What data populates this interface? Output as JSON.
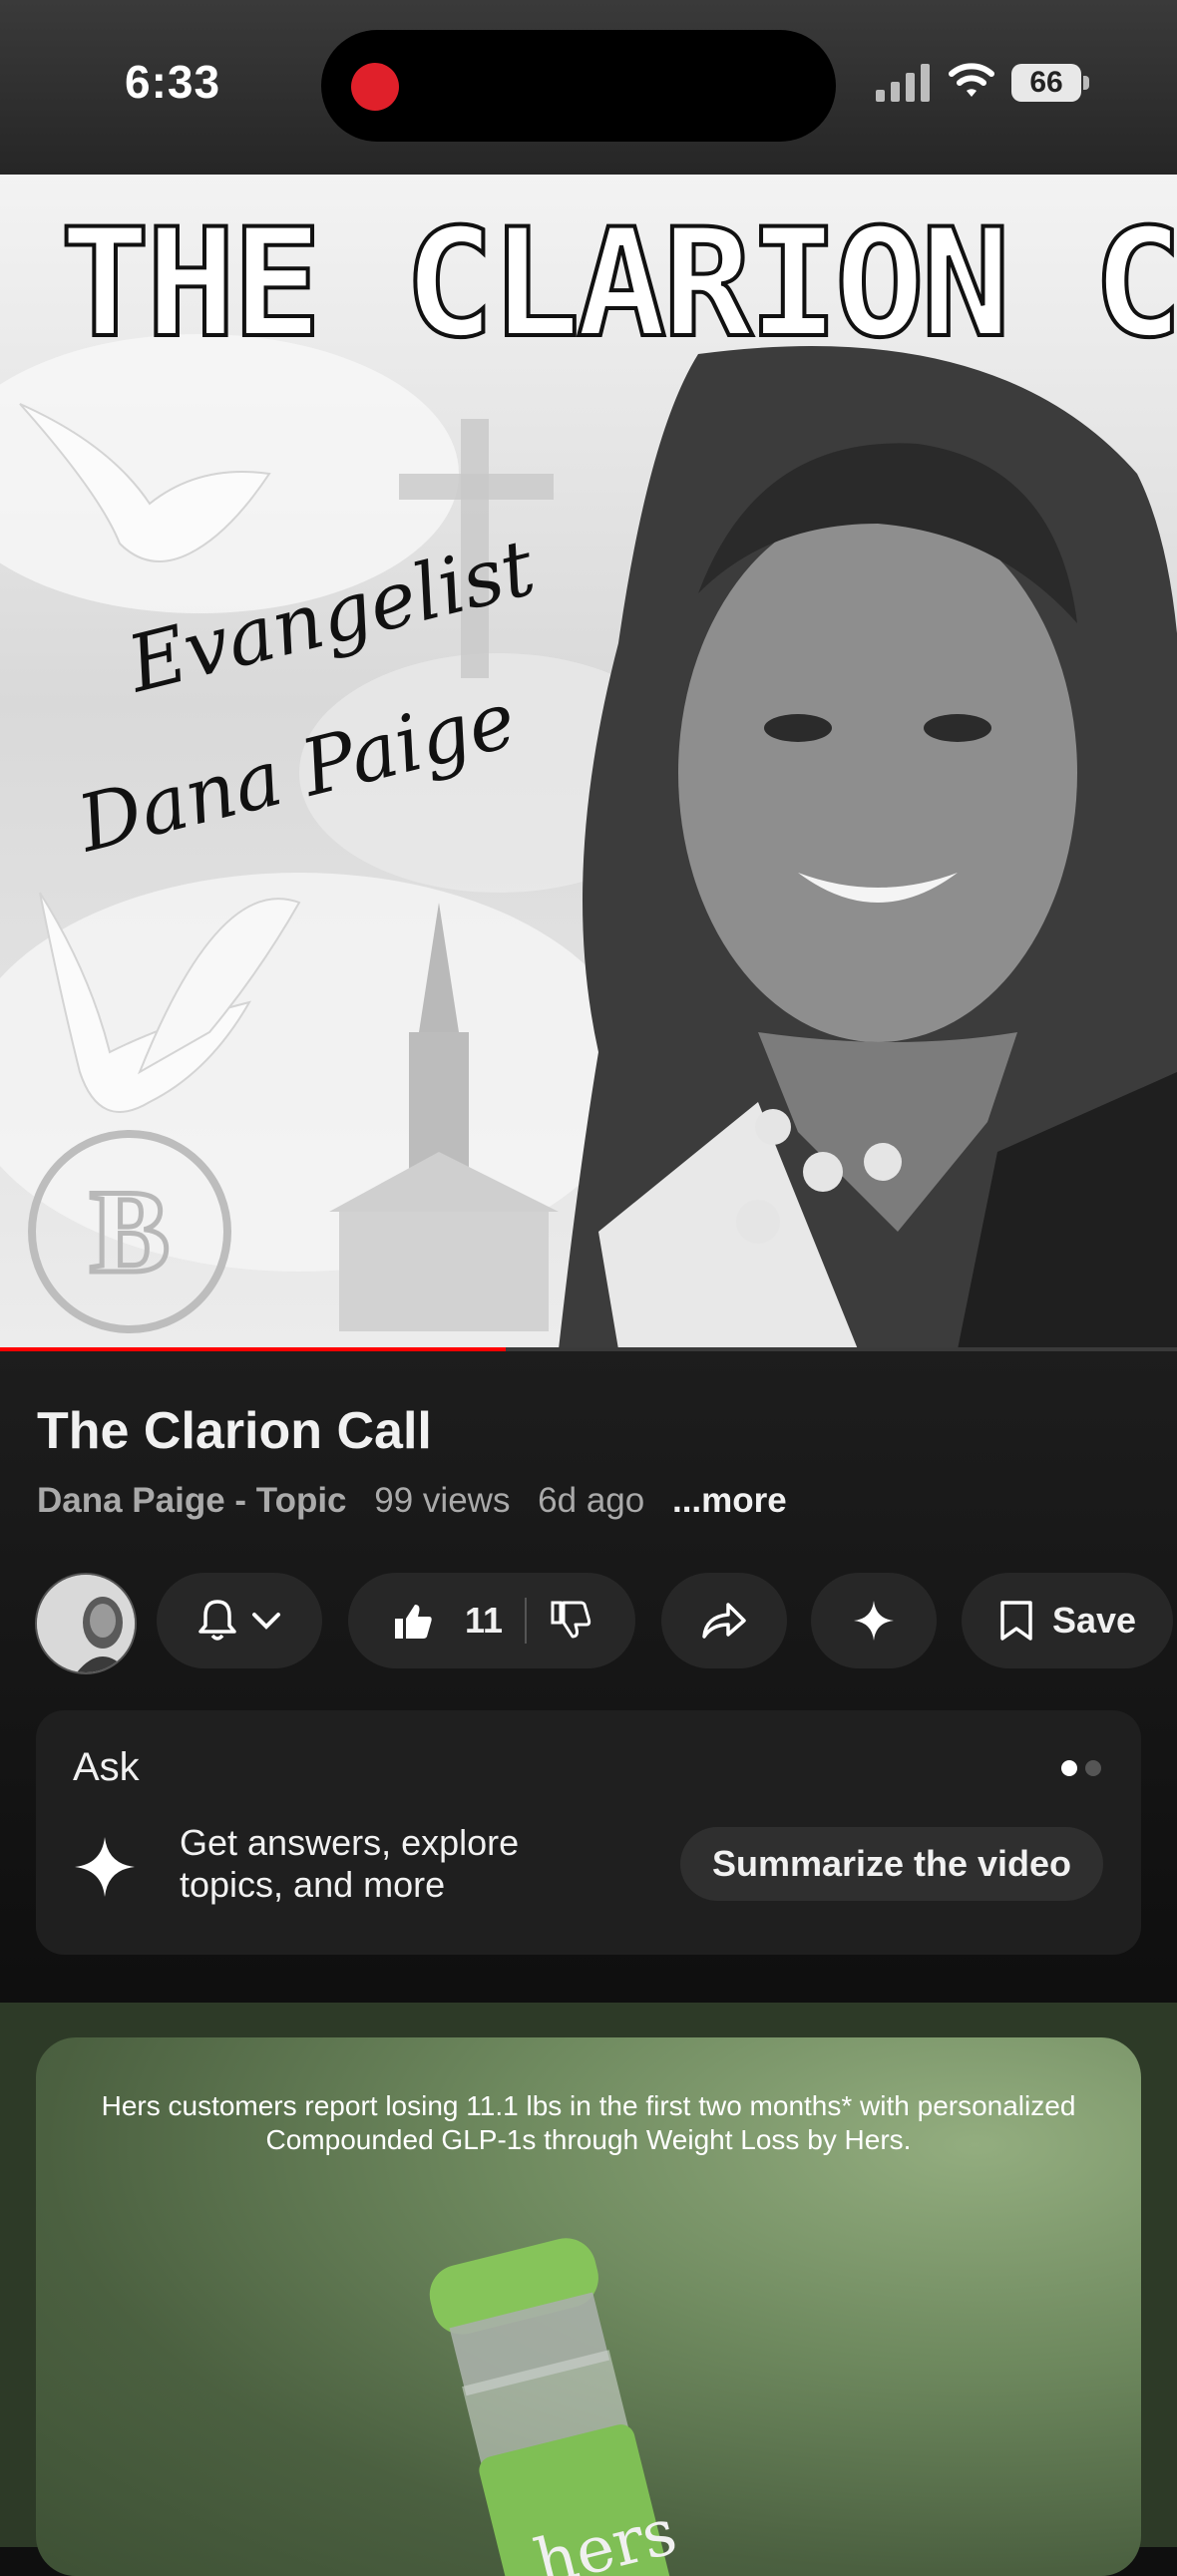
{
  "status_bar": {
    "time": "6:33",
    "battery": "66"
  },
  "video": {
    "thumbnail_title": "THE CLARION CALL",
    "thumbnail_subtitle_line1": "Evangelist",
    "thumbnail_subtitle_line2": "Dana Paige",
    "progress": 0.43
  },
  "info": {
    "title": "The Clarion Call",
    "channel": "Dana Paige - Topic",
    "views": "99 views",
    "age": "6d ago",
    "more": "...more"
  },
  "actions": {
    "like_count": "11",
    "save_label": "Save"
  },
  "ask": {
    "title": "Ask",
    "description": "Get answers, explore topics, and more",
    "summarize_label": "Summarize the video",
    "pages": 2,
    "active_page": 1
  },
  "ad": {
    "headline": "Hers customers report losing 11.1 lbs in the first two months* with personalized Compounded GLP-1s through Weight Loss by Hers.",
    "brand": "hers"
  },
  "colors": {
    "background": "#0f0f0f",
    "pill": "#272727",
    "record": "#e0202a",
    "ad_green": "#6f8a5f"
  }
}
